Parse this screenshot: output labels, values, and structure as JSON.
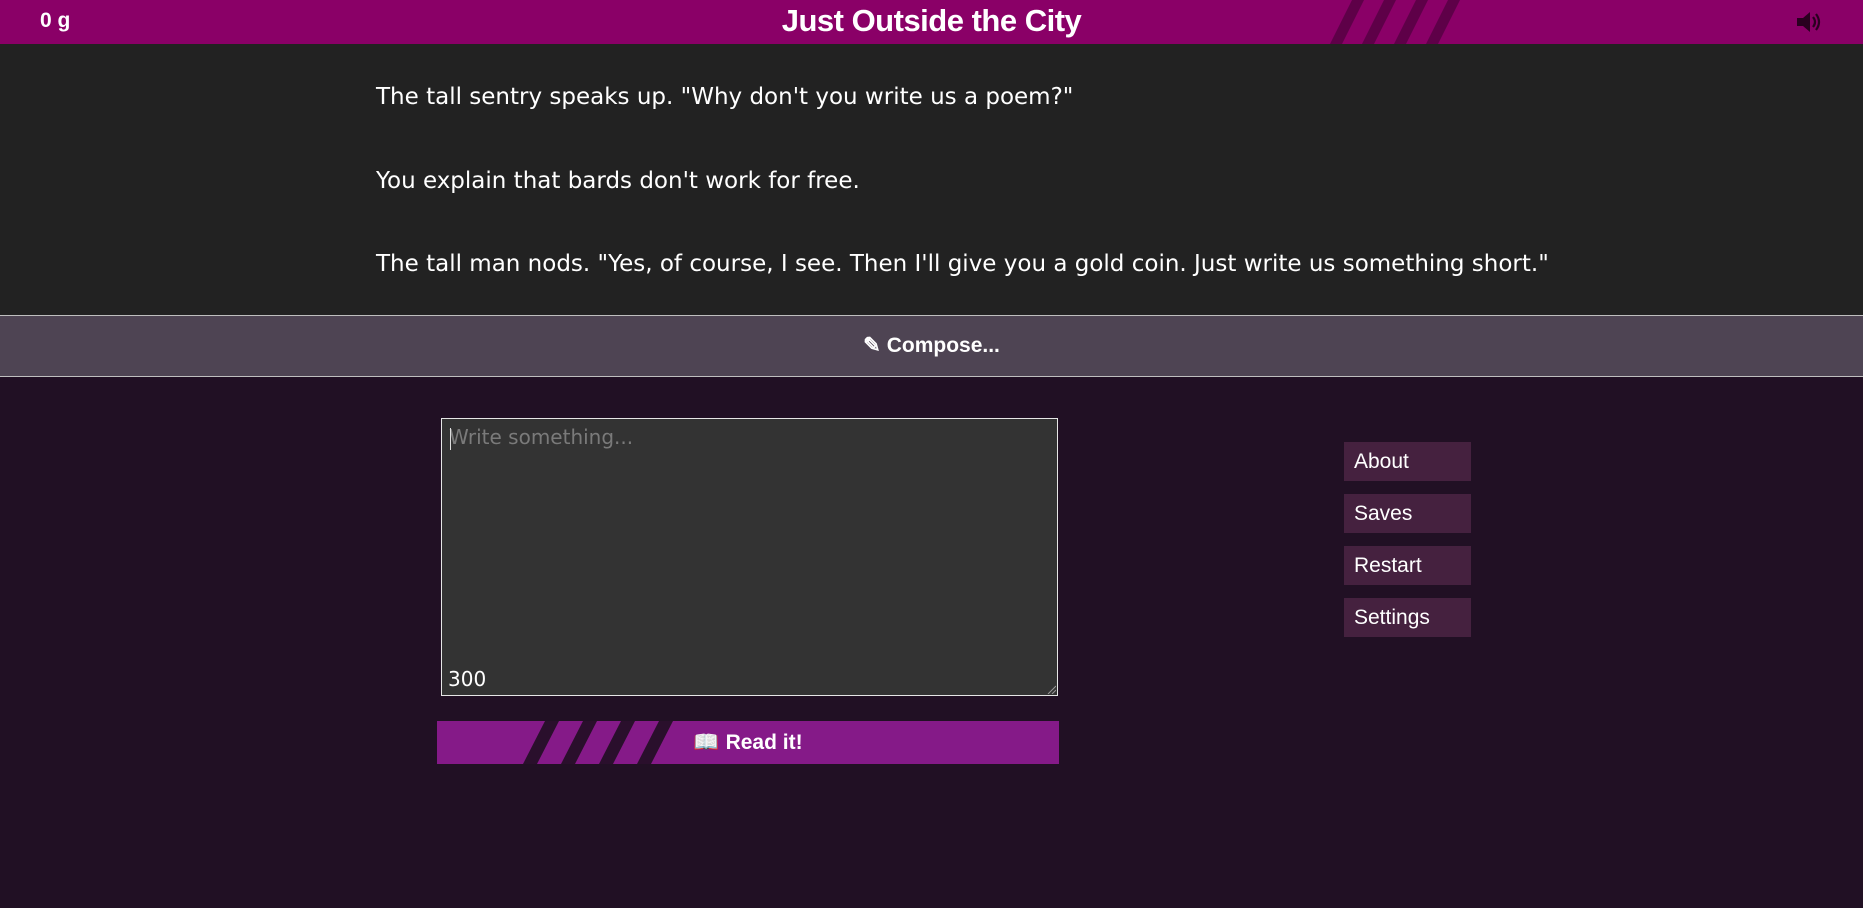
{
  "header": {
    "gold": "0 g",
    "title": "Just Outside the City",
    "sound_icon": "speaker-icon",
    "accent_color": "#8a0067"
  },
  "story": {
    "paragraphs": [
      "The tall sentry speaks up. \"Why don't you write us a poem?\"",
      "You explain that bards don't work for free.",
      "The tall man nods. \"Yes, of course, I see. Then I'll give you a gold coin. Just write us something short.\""
    ]
  },
  "compose": {
    "icon": "pencil-icon",
    "label": "Compose...",
    "placeholder": "Write something...",
    "value": "",
    "char_counter": "300"
  },
  "read_button": {
    "icon": "book-icon",
    "label": "Read it!",
    "color": "#851a88"
  },
  "menu": {
    "items": [
      {
        "label": "About"
      },
      {
        "label": "Saves"
      },
      {
        "label": "Restart"
      },
      {
        "label": "Settings"
      }
    ]
  }
}
